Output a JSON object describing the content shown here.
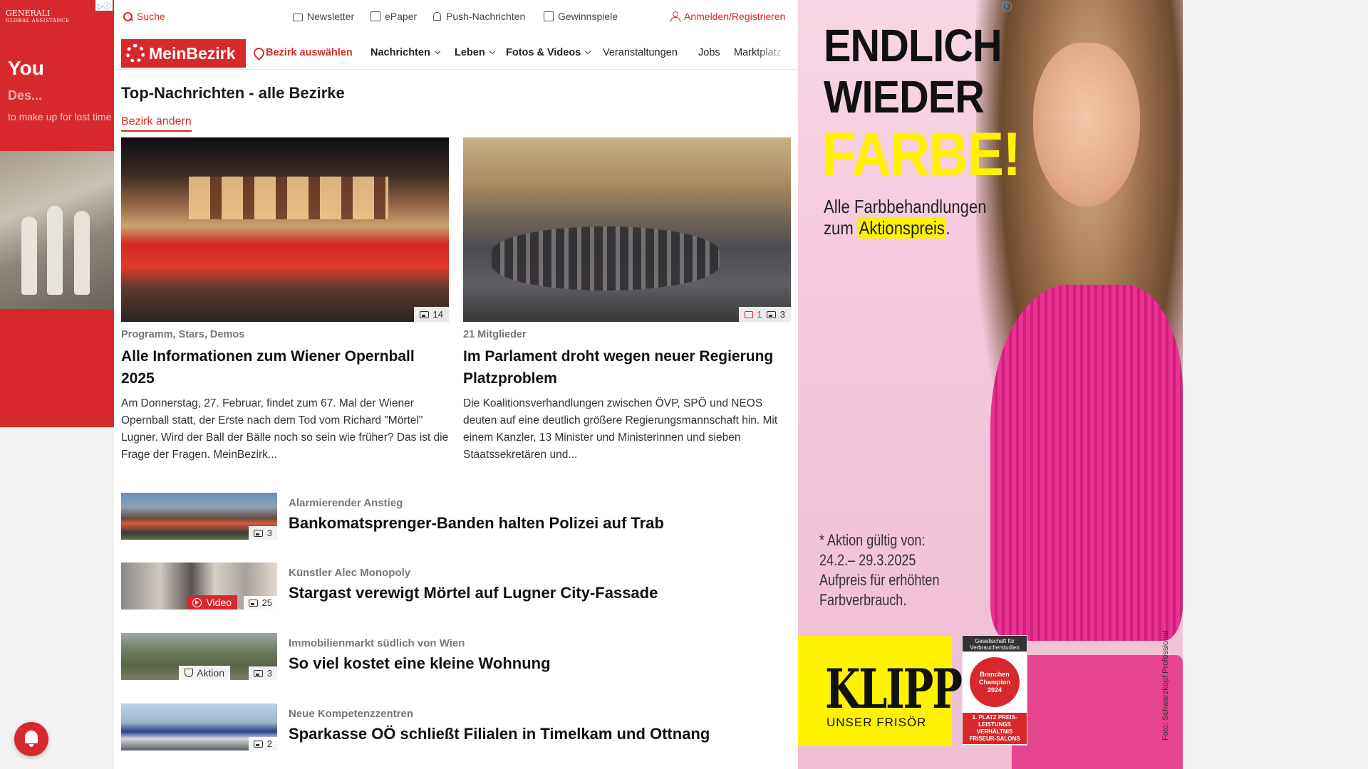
{
  "colors": {
    "brand_red": "#d7292c",
    "ad_yellow": "#fff200",
    "ad_pink": "#f4c9dc"
  },
  "left_ad": {
    "brand": "GENERALI",
    "brand_sub": "GLOBAL ASSISTANCE",
    "headline": "You",
    "headline2": "Des...",
    "sub": "to make up for lost time"
  },
  "topbar": {
    "search": "Suche",
    "newsletter": "Newsletter",
    "epaper": "ePaper",
    "push": "Push-Nachrichten",
    "gewinnspiele": "Gewinnspiele",
    "login": "Anmelden/Registrieren"
  },
  "nav": {
    "logo": "MeinBezirk",
    "select_district": "Bezirk auswählen",
    "items": [
      "Nachrichten",
      "Leben",
      "Fotos & Videos",
      "Veranstaltungen",
      "Jobs",
      "Marktplatz"
    ]
  },
  "page": {
    "title": "Top-Nachrichten - alle Bezirke",
    "change_district": "Bezirk ändern"
  },
  "featured": [
    {
      "kicker": "Programm, Stars, Demos",
      "title": "Alle Informationen zum Wiener Opernball 2025",
      "teaser": "Am Donnerstag, 27. Februar, findet zum 67. Mal der Wiener Opernball statt, der Erste nach dem Tod vom Richard \"Mörtel\" Lugner. Wird der Ball der Bälle noch so sein wie früher? Das ist die Frage der Fragen. MeinBezirk...",
      "images": "14"
    },
    {
      "kicker": "21 Mitglieder",
      "title": "Im Parlament droht wegen neuer Regierung Platzproblem",
      "teaser": "Die Koalitionsverhandlungen zwischen ÖVP, SPÖ und NEOS deuten auf eine deutlich größere Regierungsmannschaft hin. Mit einem Kanzler, 13 Minister und Ministerinnen und sieben Staatssekretären und...",
      "comments": "1",
      "images": "3"
    }
  ],
  "list": [
    {
      "kicker": "Alarmierender Anstieg",
      "title": "Bankomatsprenger-Banden halten Polizei auf Trab",
      "images": "3"
    },
    {
      "kicker": "Künstler Alec Monopoly",
      "title": "Stargast verewigt Mörtel auf Lugner City-Fassade",
      "video": "Video",
      "images": "25"
    },
    {
      "kicker": "Immobilienmarkt südlich von Wien",
      "title": "So viel kostet eine kleine Wohnung",
      "aktion": "Aktion",
      "images": "3"
    },
    {
      "kicker": "Neue Kompetenzzentren",
      "title": "Sparkasse OÖ schließt Filialen in Timelkam und Ottnang",
      "images": "2"
    }
  ],
  "right_ad": {
    "line1": "ENDLICH",
    "line2": "WIEDER",
    "line3": "FARBE!",
    "desc1": "Alle Farbbehandlungen",
    "desc2_pre": "zum ",
    "desc2_hl": "Aktionspreis",
    "desc2_post": ".",
    "cond1": "* Aktion gültig von:",
    "cond2": "24.2.– 29.3.2025",
    "cond3": "Aufpreis für erhöhten",
    "cond4": "Farbverbrauch.",
    "brand": "KLIPP",
    "brand_sub": "UNSER FRISÖR",
    "award_top": "Gesellschaft für Verbraucherstudien GmbH",
    "award_mid1": "Branchen",
    "award_mid2": "Champion",
    "award_year": "2024",
    "award_bottom": "1. PLATZ PREIS-LEISTUNGS VERHÄLTNIS FRISEUR-SALONS",
    "credit": "Foto: Schwarzkopf Professional"
  }
}
